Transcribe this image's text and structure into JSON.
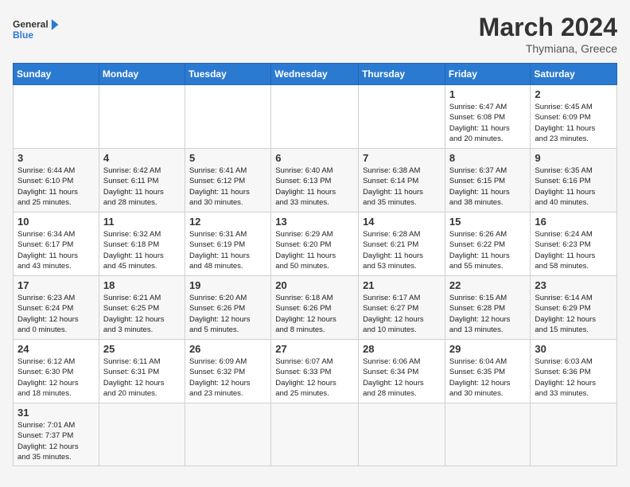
{
  "header": {
    "logo_general": "General",
    "logo_blue": "Blue",
    "month_title": "March 2024",
    "subtitle": "Thymiana, Greece"
  },
  "days_of_week": [
    "Sunday",
    "Monday",
    "Tuesday",
    "Wednesday",
    "Thursday",
    "Friday",
    "Saturday"
  ],
  "weeks": [
    [
      {
        "day": "",
        "info": ""
      },
      {
        "day": "",
        "info": ""
      },
      {
        "day": "",
        "info": ""
      },
      {
        "day": "",
        "info": ""
      },
      {
        "day": "",
        "info": ""
      },
      {
        "day": "1",
        "info": "Sunrise: 6:47 AM\nSunset: 6:08 PM\nDaylight: 11 hours\nand 20 minutes."
      },
      {
        "day": "2",
        "info": "Sunrise: 6:45 AM\nSunset: 6:09 PM\nDaylight: 11 hours\nand 23 minutes."
      }
    ],
    [
      {
        "day": "3",
        "info": "Sunrise: 6:44 AM\nSunset: 6:10 PM\nDaylight: 11 hours\nand 25 minutes."
      },
      {
        "day": "4",
        "info": "Sunrise: 6:42 AM\nSunset: 6:11 PM\nDaylight: 11 hours\nand 28 minutes."
      },
      {
        "day": "5",
        "info": "Sunrise: 6:41 AM\nSunset: 6:12 PM\nDaylight: 11 hours\nand 30 minutes."
      },
      {
        "day": "6",
        "info": "Sunrise: 6:40 AM\nSunset: 6:13 PM\nDaylight: 11 hours\nand 33 minutes."
      },
      {
        "day": "7",
        "info": "Sunrise: 6:38 AM\nSunset: 6:14 PM\nDaylight: 11 hours\nand 35 minutes."
      },
      {
        "day": "8",
        "info": "Sunrise: 6:37 AM\nSunset: 6:15 PM\nDaylight: 11 hours\nand 38 minutes."
      },
      {
        "day": "9",
        "info": "Sunrise: 6:35 AM\nSunset: 6:16 PM\nDaylight: 11 hours\nand 40 minutes."
      }
    ],
    [
      {
        "day": "10",
        "info": "Sunrise: 6:34 AM\nSunset: 6:17 PM\nDaylight: 11 hours\nand 43 minutes."
      },
      {
        "day": "11",
        "info": "Sunrise: 6:32 AM\nSunset: 6:18 PM\nDaylight: 11 hours\nand 45 minutes."
      },
      {
        "day": "12",
        "info": "Sunrise: 6:31 AM\nSunset: 6:19 PM\nDaylight: 11 hours\nand 48 minutes."
      },
      {
        "day": "13",
        "info": "Sunrise: 6:29 AM\nSunset: 6:20 PM\nDaylight: 11 hours\nand 50 minutes."
      },
      {
        "day": "14",
        "info": "Sunrise: 6:28 AM\nSunset: 6:21 PM\nDaylight: 11 hours\nand 53 minutes."
      },
      {
        "day": "15",
        "info": "Sunrise: 6:26 AM\nSunset: 6:22 PM\nDaylight: 11 hours\nand 55 minutes."
      },
      {
        "day": "16",
        "info": "Sunrise: 6:24 AM\nSunset: 6:23 PM\nDaylight: 11 hours\nand 58 minutes."
      }
    ],
    [
      {
        "day": "17",
        "info": "Sunrise: 6:23 AM\nSunset: 6:24 PM\nDaylight: 12 hours\nand 0 minutes."
      },
      {
        "day": "18",
        "info": "Sunrise: 6:21 AM\nSunset: 6:25 PM\nDaylight: 12 hours\nand 3 minutes."
      },
      {
        "day": "19",
        "info": "Sunrise: 6:20 AM\nSunset: 6:26 PM\nDaylight: 12 hours\nand 5 minutes."
      },
      {
        "day": "20",
        "info": "Sunrise: 6:18 AM\nSunset: 6:26 PM\nDaylight: 12 hours\nand 8 minutes."
      },
      {
        "day": "21",
        "info": "Sunrise: 6:17 AM\nSunset: 6:27 PM\nDaylight: 12 hours\nand 10 minutes."
      },
      {
        "day": "22",
        "info": "Sunrise: 6:15 AM\nSunset: 6:28 PM\nDaylight: 12 hours\nand 13 minutes."
      },
      {
        "day": "23",
        "info": "Sunrise: 6:14 AM\nSunset: 6:29 PM\nDaylight: 12 hours\nand 15 minutes."
      }
    ],
    [
      {
        "day": "24",
        "info": "Sunrise: 6:12 AM\nSunset: 6:30 PM\nDaylight: 12 hours\nand 18 minutes."
      },
      {
        "day": "25",
        "info": "Sunrise: 6:11 AM\nSunset: 6:31 PM\nDaylight: 12 hours\nand 20 minutes."
      },
      {
        "day": "26",
        "info": "Sunrise: 6:09 AM\nSunset: 6:32 PM\nDaylight: 12 hours\nand 23 minutes."
      },
      {
        "day": "27",
        "info": "Sunrise: 6:07 AM\nSunset: 6:33 PM\nDaylight: 12 hours\nand 25 minutes."
      },
      {
        "day": "28",
        "info": "Sunrise: 6:06 AM\nSunset: 6:34 PM\nDaylight: 12 hours\nand 28 minutes."
      },
      {
        "day": "29",
        "info": "Sunrise: 6:04 AM\nSunset: 6:35 PM\nDaylight: 12 hours\nand 30 minutes."
      },
      {
        "day": "30",
        "info": "Sunrise: 6:03 AM\nSunset: 6:36 PM\nDaylight: 12 hours\nand 33 minutes."
      }
    ],
    [
      {
        "day": "31",
        "info": "Sunrise: 7:01 AM\nSunset: 7:37 PM\nDaylight: 12 hours\nand 35 minutes."
      },
      {
        "day": "",
        "info": ""
      },
      {
        "day": "",
        "info": ""
      },
      {
        "day": "",
        "info": ""
      },
      {
        "day": "",
        "info": ""
      },
      {
        "day": "",
        "info": ""
      },
      {
        "day": "",
        "info": ""
      }
    ]
  ]
}
